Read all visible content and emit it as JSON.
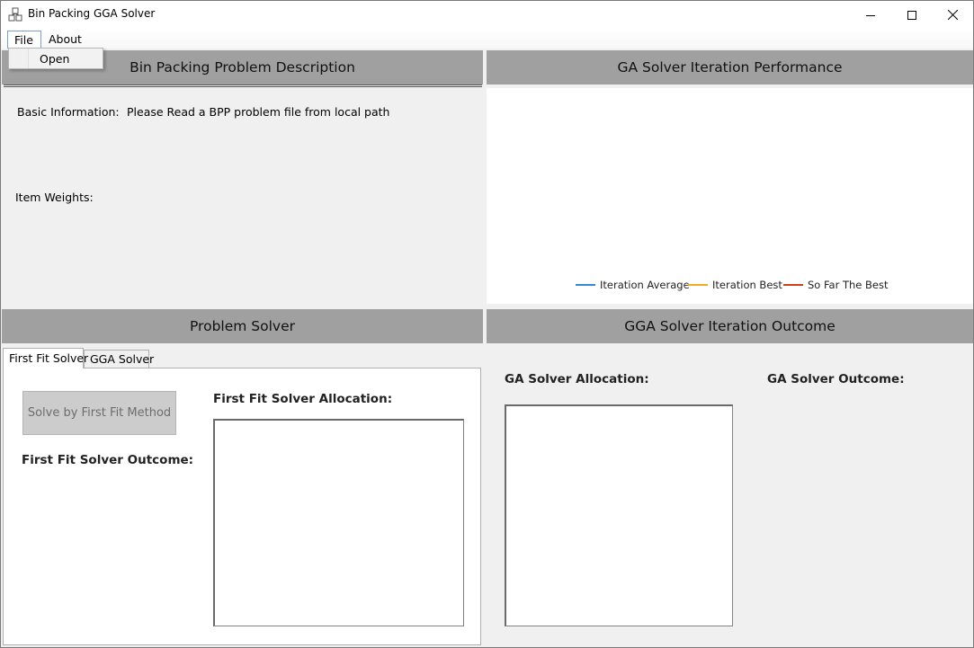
{
  "window": {
    "title": "Bin Packing GGA Solver",
    "controls": {
      "minimize": "–",
      "maximize": "□",
      "close": "✕"
    }
  },
  "menu": {
    "file": "File",
    "about": "About",
    "file_dropdown": {
      "open": "Open"
    }
  },
  "panels": {
    "description": {
      "header": "Bin Packing Problem Description",
      "basic_info_label": "Basic Information:",
      "basic_info_value": "Please Read  a BPP problem file from local path",
      "item_weights_label": "Item Weights:"
    },
    "performance": {
      "header": "GA Solver Iteration Performance",
      "legend": [
        {
          "label": "Iteration Average",
          "color": "#3a86d6"
        },
        {
          "label": "Iteration Best",
          "color": "#f5a623"
        },
        {
          "label": "So Far The Best",
          "color": "#d0401a"
        }
      ]
    },
    "solver": {
      "header": "Problem Solver",
      "tabs": [
        {
          "label": "First Fit Solver",
          "selected": true
        },
        {
          "label": "GGA Solver",
          "selected": false
        }
      ],
      "solve_button": "Solve by First Fit Method",
      "allocation_label": "First Fit Solver Allocation:",
      "outcome_label": "First Fit Solver Outcome:"
    },
    "outcome": {
      "header": "GGA Solver Iteration Outcome",
      "allocation_label": "GA Solver Allocation:",
      "outcome_label": "GA Solver Outcome:"
    }
  }
}
